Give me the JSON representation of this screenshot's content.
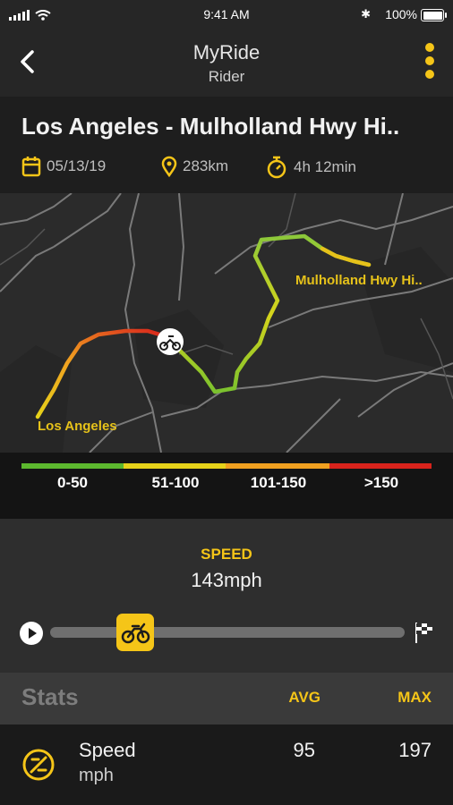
{
  "status_bar": {
    "time": "9:41 AM",
    "battery": "100%"
  },
  "header": {
    "title": "MyRide",
    "subtitle": "Rider"
  },
  "route": {
    "title": "Los Angeles - Mulholland Hwy Hi..",
    "date": "05/13/19",
    "distance": "283km",
    "duration": "4h 12min"
  },
  "map": {
    "start_label": "Los Angeles",
    "end_label": "Mulholland Hwy Hi.."
  },
  "legend": {
    "ranges": [
      {
        "label": "0-50",
        "color": "#5cb82e"
      },
      {
        "label": "51-100",
        "color": "#e6d21a"
      },
      {
        "label": "101-150",
        "color": "#f0a020"
      },
      {
        "label": ">150",
        "color": "#d8231c"
      }
    ]
  },
  "playback": {
    "label": "SPEED",
    "value": "143mph",
    "progress": 0.24
  },
  "stats": {
    "title": "Stats",
    "avg_label": "AVG",
    "max_label": "MAX",
    "rows": [
      {
        "name": "Speed",
        "unit": "mph",
        "avg": "95",
        "max": "197",
        "icon": "speedometer-icon"
      }
    ]
  },
  "colors": {
    "accent": "#f5c518",
    "background": "#1c1c1c"
  }
}
